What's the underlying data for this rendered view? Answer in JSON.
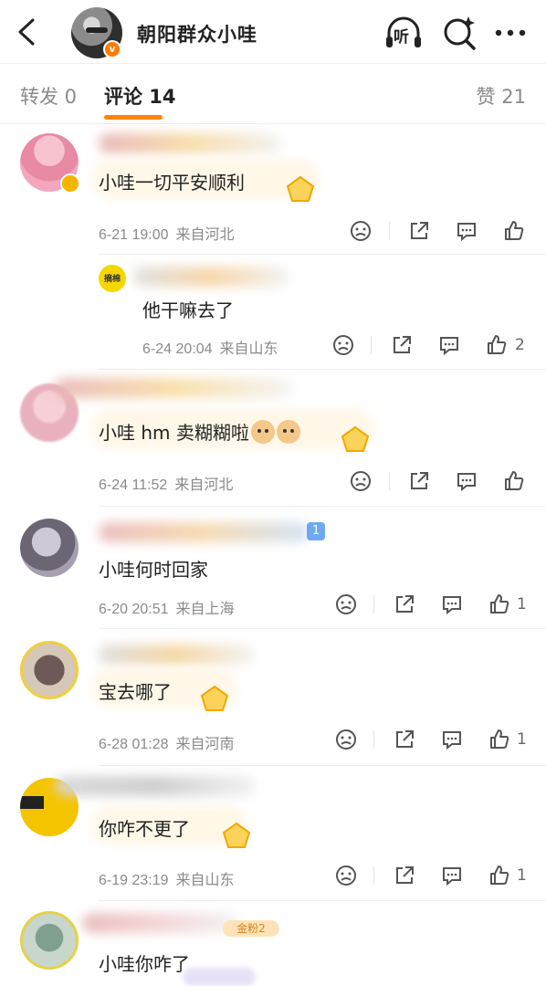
{
  "header": {
    "title": "朝阳群众小哇",
    "listen_label": "听",
    "verified_badge": "v",
    "icons": [
      "back-arrow-icon",
      "listen-headphones-icon",
      "search-spark-icon",
      "more-icon"
    ]
  },
  "tabs": {
    "forward": "转发 0",
    "comments": "评论 14",
    "likes": "赞 21"
  },
  "colors": {
    "accent": "#ff8200",
    "text": "#222222",
    "muted": "#8a8a8a"
  },
  "comments": [
    {
      "text": "小哇一切平安顺利",
      "time": "6-21 19:00",
      "location": "来自河北",
      "likes": ""
    },
    {
      "text": "他干嘛去了",
      "time": "6-24 20:04",
      "location": "来自山东",
      "likes": "2",
      "avatar_label": "摘棉",
      "reply": true
    },
    {
      "text": "小哇 hm 卖糊糊啦",
      "time": "6-24 11:52",
      "location": "来自河北",
      "likes": ""
    },
    {
      "text": "小哇何时回家",
      "time": "6-20 20:51",
      "location": "来自上海",
      "likes": "1",
      "badge": "1"
    },
    {
      "text": "宝去哪了",
      "time": "6-28 01:28",
      "location": "来自河南",
      "likes": "1"
    },
    {
      "text": "你咋不更了",
      "time": "6-19 23:19",
      "location": "来自山东",
      "likes": "1"
    },
    {
      "text": "小哇你咋了",
      "badge": "金粉2"
    }
  ]
}
